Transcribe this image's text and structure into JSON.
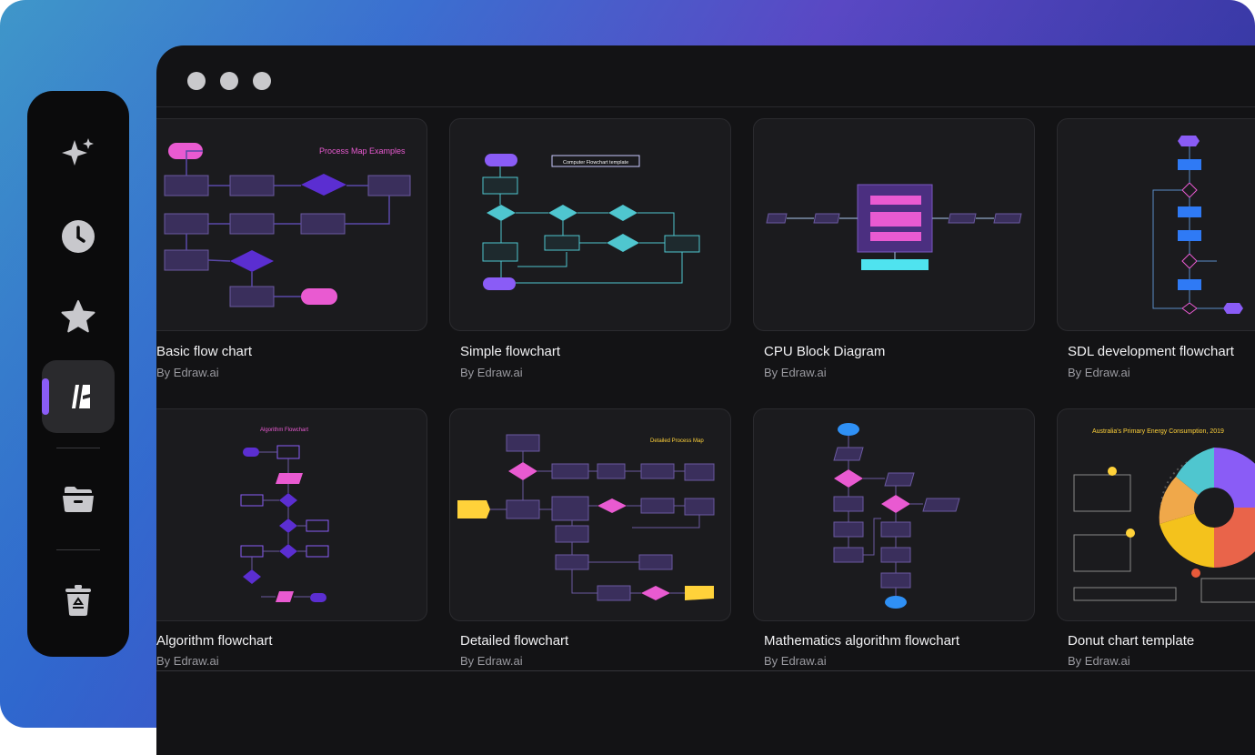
{
  "sidebar": {
    "items": [
      {
        "icon": "sparkle-icon",
        "label": "AI"
      },
      {
        "icon": "clock-icon",
        "label": "Recent"
      },
      {
        "icon": "star-icon",
        "label": "Favorites"
      },
      {
        "icon": "templates-icon",
        "label": "Templates",
        "active": true
      },
      {
        "icon": "folder-icon",
        "label": "Files"
      },
      {
        "icon": "recycle-bin-icon",
        "label": "Recycle bin"
      }
    ]
  },
  "templates": [
    {
      "title": "Basic flow chart",
      "author": "By Edraw.ai",
      "preview_heading": "Process Map Examples"
    },
    {
      "title": "Simple flowchart",
      "author": "By Edraw.ai",
      "preview_heading": "Computer Flowchart template"
    },
    {
      "title": "CPU Block Diagram",
      "author": "By Edraw.ai",
      "preview_heading": ""
    },
    {
      "title": "SDL development flowchart",
      "author": "By Edraw.ai",
      "preview_heading": ""
    },
    {
      "title": "Algorithm flowchart",
      "author": "By Edraw.ai",
      "preview_heading": "Algorithm Flowchart"
    },
    {
      "title": "Detailed flowchart",
      "author": "By Edraw.ai",
      "preview_heading": "Detailed Process Map"
    },
    {
      "title": "Mathematics algorithm flowchart",
      "author": "By Edraw.ai",
      "preview_heading": ""
    },
    {
      "title": "Donut chart template",
      "author": "By Edraw.ai",
      "preview_heading": "Australia's Primary Energy Consumption, 2019"
    }
  ],
  "colors": {
    "accent": "#8a5cf6",
    "node_purple": "#3a2f5c",
    "node_pink": "#e95ad1",
    "teal": "#4fc6cf",
    "background": "#131315"
  }
}
